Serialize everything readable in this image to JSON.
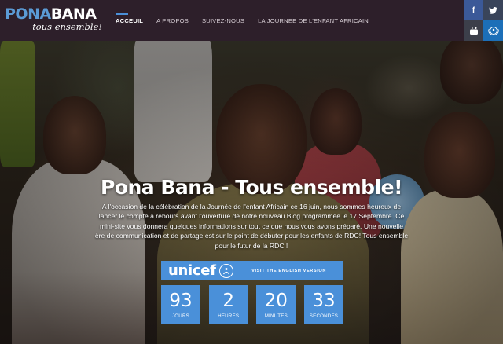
{
  "logo": {
    "part1": "PONA",
    "part2": "BANA",
    "tagline": "tous ensemble!"
  },
  "nav": {
    "items": [
      {
        "label": "ACCEUIL",
        "active": true
      },
      {
        "label": "A PROPOS",
        "active": false
      },
      {
        "label": "SUIVEZ-NOUS",
        "active": false
      },
      {
        "label": "LA JOURNEE DE L'ENFANT AFRICAIN",
        "active": false
      }
    ]
  },
  "social": {
    "facebook": "f",
    "icons": [
      "facebook-icon",
      "twitter-icon",
      "youtube-icon",
      "unicef-icon"
    ]
  },
  "hero": {
    "headline": "Pona Bana - Tous ensemble!",
    "intro": "A l'occasion de la célébration de la Journée de l'enfant Africain ce 16 juin, nous sommes heureux de lancer le compte à rebours avant l'ouverture de notre nouveau Blog programmée le 17 Septembre. Ce mini-site vous donnera quelques informations sur tout ce que nous vous avons préparé. Une nouvelle ère de communication et de partage est sur le point de débuter pour les enfants de RDC! Tous ensemble pour le futur de la RDC !"
  },
  "unicef": {
    "logo_text": "unicef",
    "link_label": "VISIT THE ENGLISH VERSION"
  },
  "countdown": [
    {
      "value": "93",
      "label": "JOURS"
    },
    {
      "value": "2",
      "label": "HEURES"
    },
    {
      "value": "20",
      "label": "MINUTES"
    },
    {
      "value": "33",
      "label": "SECONDES"
    }
  ],
  "colors": {
    "accent": "#4a90d9",
    "header_bg": "#2d1f2a",
    "logo_blue": "#5b9bd5"
  }
}
